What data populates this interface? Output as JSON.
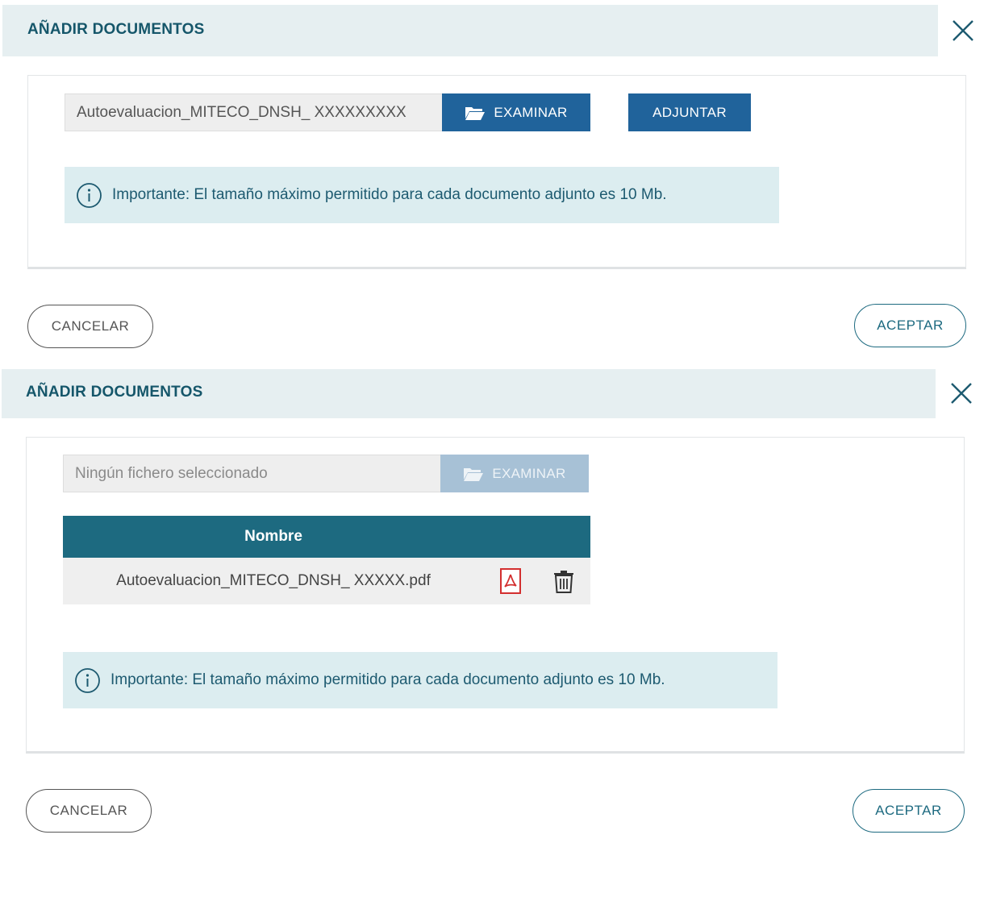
{
  "dialog1": {
    "title": "AÑADIR DOCUMENTOS",
    "file_value": "Autoevaluacion_MITECO_DNSH_ XXXXXXXXX",
    "examinar_label": "EXAMINAR",
    "adjuntar_label": "ADJUNTAR",
    "info_text": "Importante: El tamaño máximo permitido para cada documento adjunto es 10 Mb.",
    "cancel_label": "CANCELAR",
    "accept_label": "ACEPTAR"
  },
  "dialog2": {
    "title": "AÑADIR DOCUMENTOS",
    "file_placeholder": "Ningún fichero seleccionado",
    "examinar_label": "EXAMINAR",
    "table": {
      "header_name": "Nombre",
      "rows": [
        {
          "name": "Autoevaluacion_MITECO_DNSH_ XXXXX.pdf",
          "icons": [
            "pdf-icon",
            "trash-icon"
          ]
        }
      ]
    },
    "info_text": "Importante: El tamaño máximo permitido para cada documento adjunto es 10 Mb.",
    "cancel_label": "CANCELAR",
    "accept_label": "ACEPTAR"
  },
  "colors": {
    "header_bg": "#e6eff1",
    "title": "#15566a",
    "primary_button": "#20639b",
    "disabled_button": "#a7c1d6",
    "table_header": "#1d6a80",
    "info_bg": "#dcedf0",
    "pdf_icon": "#d32f2f"
  }
}
